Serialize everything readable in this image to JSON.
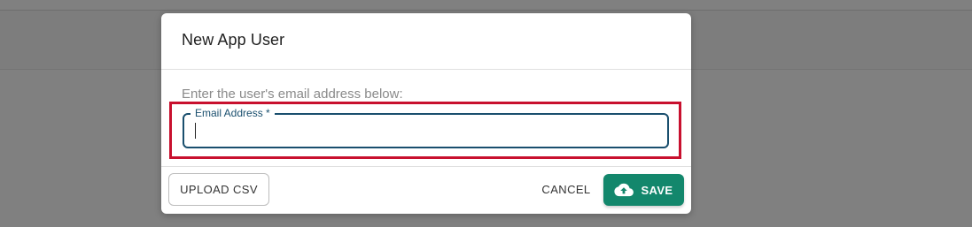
{
  "dialog": {
    "title": "New App User",
    "instruction": "Enter the user's email address below:",
    "email_field": {
      "label": "Email Address *",
      "value": "",
      "placeholder": ""
    },
    "footer": {
      "upload_label": "UPLOAD CSV",
      "cancel_label": "CANCEL",
      "save_label": "SAVE",
      "save_icon": "cloud-upload-icon"
    }
  },
  "colors": {
    "accent": "#13876c",
    "field_border": "#1a4f6e",
    "highlight": "#c8102e"
  }
}
